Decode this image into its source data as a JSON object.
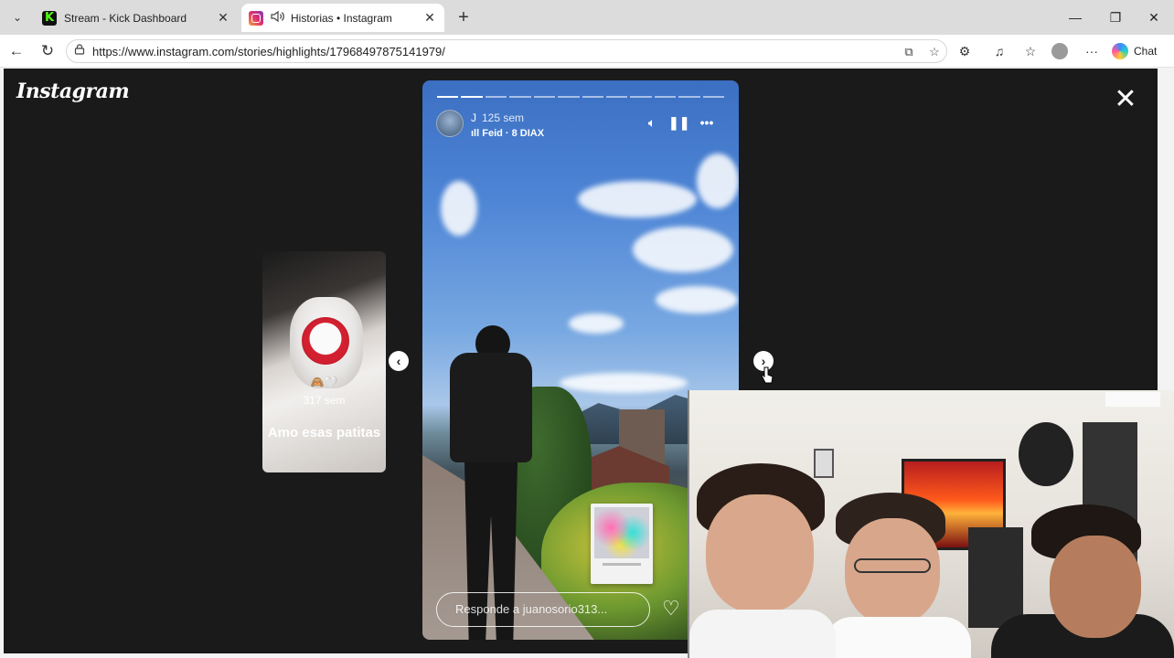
{
  "browser": {
    "tabs": [
      {
        "title": "Stream - Kick Dashboard",
        "icon": "kick-favicon",
        "active": false
      },
      {
        "title": "Historias • Instagram",
        "icon": "instagram-favicon",
        "active": true,
        "audio": true
      }
    ],
    "url": "https://www.instagram.com/stories/highlights/17968497875141979/",
    "chat_label": "Chat"
  },
  "instagram": {
    "logo": "Instagram",
    "prev_story": {
      "emoji": "🙈🤍",
      "time": "317 sem",
      "caption": "Amo esas patitas"
    },
    "story": {
      "username": "J",
      "time": "125 sem",
      "music": "Feid · 8 DIAX",
      "reply_placeholder": "Responde a juanosorio313...",
      "progress_done": 2,
      "progress_total": 12
    }
  },
  "colors": {
    "viewer_bg": "#1a1a1a",
    "tabstrip_bg": "#dcdcdc",
    "kick_green": "#53fc18"
  }
}
